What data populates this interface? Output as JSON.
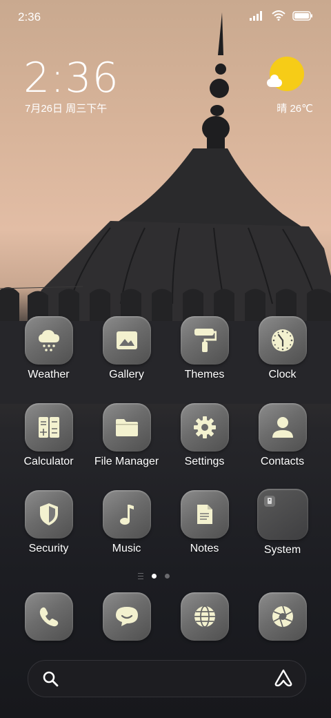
{
  "status_bar": {
    "time": "2:36",
    "icons": [
      "signal-icon",
      "wifi-icon",
      "battery-icon"
    ]
  },
  "widget": {
    "clock": "2:36",
    "date": "7月26日 周三下午",
    "weather_text": "晴 26℃",
    "weather_icon": "sun-cloud-icon"
  },
  "apps": [
    {
      "label": "Weather",
      "icon": "weather-icon"
    },
    {
      "label": "Gallery",
      "icon": "gallery-icon"
    },
    {
      "label": "Themes",
      "icon": "themes-icon"
    },
    {
      "label": "Clock",
      "icon": "clock-icon"
    },
    {
      "label": "Calculator",
      "icon": "calculator-icon"
    },
    {
      "label": "File Manager",
      "icon": "folder-icon"
    },
    {
      "label": "Settings",
      "icon": "gear-icon"
    },
    {
      "label": "Contacts",
      "icon": "person-icon"
    },
    {
      "label": "Security",
      "icon": "shield-icon"
    },
    {
      "label": "Music",
      "icon": "music-note-icon"
    },
    {
      "label": "Notes",
      "icon": "document-icon"
    },
    {
      "label": "System",
      "icon": "folder-icon"
    }
  ],
  "page_indicator": {
    "pages": 2,
    "current": 1
  },
  "dock": [
    {
      "icon": "phone-icon"
    },
    {
      "icon": "message-icon"
    },
    {
      "icon": "browser-icon"
    },
    {
      "icon": "camera-icon"
    }
  ],
  "search_bar": {
    "search_icon": "search-icon",
    "assistant_icon": "assistant-icon"
  },
  "colors": {
    "icon_glyph": "#f3f1cf",
    "sun": "#f6cc17"
  }
}
